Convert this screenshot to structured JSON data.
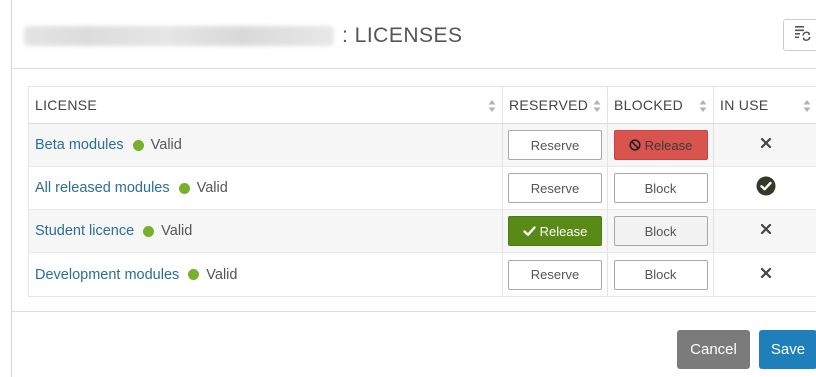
{
  "header": {
    "title": ": LICENSES",
    "refresh_icon": "refresh-list-icon"
  },
  "table": {
    "columns": [
      "LICENSE",
      "RESERVED",
      "BLOCKED",
      "IN USE"
    ],
    "rows": [
      {
        "name": "Beta modules",
        "status": "Valid",
        "reserved_label": "Reserve",
        "blocked_label": "Release",
        "blocked_state": "danger",
        "in_use": "cross"
      },
      {
        "name": "All released modules",
        "status": "Valid",
        "reserved_label": "Reserve",
        "blocked_label": "Block",
        "blocked_state": "default",
        "in_use": "check"
      },
      {
        "name": "Student licence",
        "status": "Valid",
        "reserved_label": "Release",
        "reserved_state": "success",
        "blocked_label": "Block",
        "blocked_state": "default-grey",
        "in_use": "cross"
      },
      {
        "name": "Development modules",
        "status": "Valid",
        "reserved_label": "Reserve",
        "blocked_label": "Block",
        "blocked_state": "default",
        "in_use": "cross"
      }
    ]
  },
  "footer": {
    "cancel_label": "Cancel",
    "save_label": "Save"
  },
  "colors": {
    "link": "#2a6f97",
    "valid_dot": "#78b02e",
    "danger": "#d9534f",
    "success": "#5a8a16",
    "cancel": "#7b7b7b",
    "save": "#1f7fba"
  }
}
